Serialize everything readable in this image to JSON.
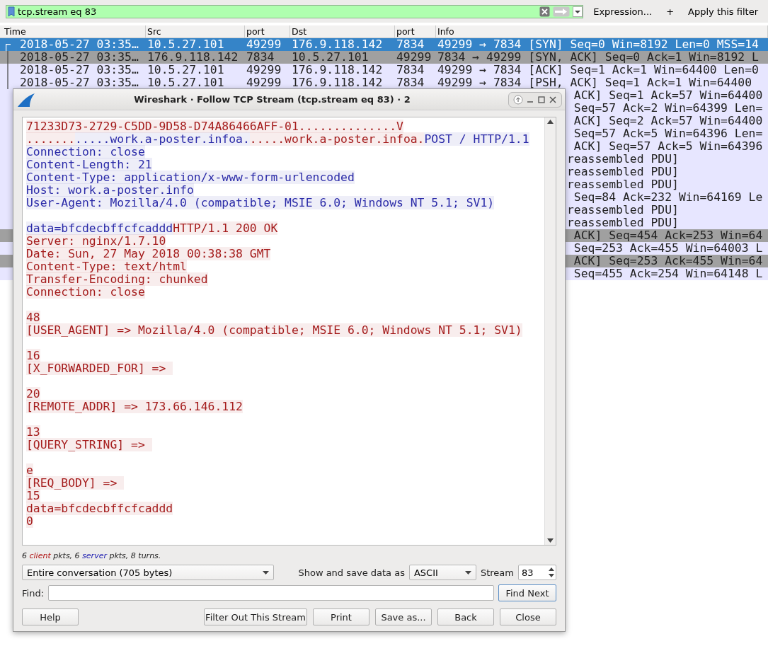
{
  "filter": {
    "value": "tcp.stream eq 83",
    "expression": "Expression...",
    "plus": "+",
    "apply": "Apply this filter"
  },
  "packet_list": {
    "columns": [
      "Time",
      "Src",
      "port",
      "Dst",
      "port",
      "Info"
    ],
    "rows": [
      {
        "kind": "full",
        "time": "2018-05-27 03:35…",
        "src": "10.5.27.101",
        "sport": "49299",
        "dst": "176.9.118.142",
        "dport": "7834",
        "info": "49299 → 7834 [SYN] Seq=0 Win=8192 Len=0 MSS=14",
        "selected": true
      },
      {
        "kind": "full",
        "time": "2018-05-27 03:35…",
        "src": "176.9.118.142",
        "sport": "7834",
        "dst": "10.5.27.101",
        "dport": "49299",
        "info": "7834 → 49299 [SYN, ACK] Seq=0 Ack=1 Win=8192 L",
        "color": "#a0a0a0",
        "selected": false
      },
      {
        "kind": "full",
        "time": "2018-05-27 03:35…",
        "src": "10.5.27.101",
        "sport": "49299",
        "dst": "176.9.118.142",
        "dport": "7834",
        "info": "49299 → 7834 [ACK] Seq=1 Ack=1 Win=64400 Len=0",
        "color": "#e7e6ff",
        "selected": false
      },
      {
        "kind": "full",
        "time": "2018-05-27 03:35…",
        "src": "10.5.27.101",
        "sport": "49299",
        "dst": "176.9.118.142",
        "dport": "7834",
        "info": "49299 → 7834 [PSH, ACK] Seq=1 Ack=1 Win=64400",
        "color": "#e7e6ff",
        "selected": false
      },
      {
        "kind": "tail",
        "info": " ACK] Seq=1 Ack=57 Win=64400",
        "color": "#e7e6ff",
        "selected": false
      },
      {
        "kind": "tail",
        "info": " Seq=57 Ack=2 Win=64399 Len=",
        "color": "#e7e6ff",
        "selected": false
      },
      {
        "kind": "tail",
        "info": " ACK] Seq=2 Ack=57 Win=64400",
        "color": "#e7e6ff",
        "selected": false
      },
      {
        "kind": "tail",
        "info": " Seq=57 Ack=5 Win=64396 Len=",
        "color": "#e7e6ff",
        "selected": false
      },
      {
        "kind": "tail",
        "info": " ACK] Seq=57 Ack=5 Win=64396",
        "color": "#e7e6ff",
        "selected": false
      },
      {
        "kind": "tail",
        "info": "reassembled PDU]",
        "color": "#e7e6ff",
        "selected": false
      },
      {
        "kind": "tail",
        "info": "reassembled PDU]",
        "color": "#e7e6ff",
        "selected": false
      },
      {
        "kind": "tail",
        "info": "reassembled PDU]",
        "color": "#e7e6ff",
        "selected": false
      },
      {
        "kind": "tail",
        "info": " Seq=84 Ack=232 Win=64169 Le",
        "color": "#e7e6ff",
        "selected": false
      },
      {
        "kind": "tail",
        "info": "reassembled PDU]",
        "color": "#e7e6ff",
        "selected": false
      },
      {
        "kind": "tail",
        "info": "reassembled PDU]",
        "color": "#e7e6ff",
        "selected": false
      },
      {
        "kind": "tail",
        "info": " ACK] Seq=454 Ack=253 Win=64",
        "color": "#a0a0a0",
        "selected": false
      },
      {
        "kind": "tail",
        "info": " Seq=253 Ack=455 Win=64003 L",
        "color": "#e7e6ff",
        "selected": false
      },
      {
        "kind": "tail",
        "info": " ACK] Seq=253 Ack=455 Win=64",
        "color": "#a0a0a0",
        "selected": false
      },
      {
        "kind": "tail",
        "info": " Seq=455 Ack=254 Win=64148 L",
        "color": "#e7e6ff",
        "selected": false
      }
    ]
  },
  "dialog": {
    "title": "Wireshark · Follow TCP Stream (tcp.stream eq 83) · 2",
    "lines": [
      {
        "segments": [
          {
            "text": "71233D73-2729-C5DD-9D58-D74A86466AFF-01..............V",
            "color": "#a51d1d"
          }
        ]
      },
      {
        "segments": [
          {
            "text": ".......",
            "color": "#a51d1d"
          },
          {
            "text": ".....work.a-poster.infoa.",
            "color": "#2b2ba8"
          },
          {
            "text": ".....work.a-poster.infoa.",
            "color": "#a51d1d"
          },
          {
            "text": "POST / HTTP/1.1",
            "color": "#2b2ba8"
          }
        ]
      },
      {
        "segments": [
          {
            "text": "Connection: close",
            "color": "#2b2ba8"
          }
        ]
      },
      {
        "segments": [
          {
            "text": "Content-Length: 21",
            "color": "#2b2ba8"
          }
        ]
      },
      {
        "segments": [
          {
            "text": "Content-Type: application/x-www-form-urlencoded",
            "color": "#2b2ba8"
          }
        ]
      },
      {
        "segments": [
          {
            "text": "Host: work.a-poster.info",
            "color": "#2b2ba8"
          }
        ]
      },
      {
        "segments": [
          {
            "text": "User-Agent: Mozilla/4.0 (compatible; MSIE 6.0; Windows NT 5.1; SV1)",
            "color": "#2b2ba8"
          }
        ]
      },
      {
        "space_before": true,
        "segments": [
          {
            "text": "data=bfcdecbffcfcaddd",
            "color": "#2b2ba8"
          },
          {
            "text": "HTTP/1.1 200 OK",
            "color": "#a51d1d"
          }
        ]
      },
      {
        "segments": [
          {
            "text": "Server: nginx/1.7.10",
            "color": "#a51d1d"
          }
        ]
      },
      {
        "segments": [
          {
            "text": "Date: Sun, 27 May 2018 00:38:38 GMT",
            "color": "#a51d1d"
          }
        ]
      },
      {
        "segments": [
          {
            "text": "Content-Type: text/html",
            "color": "#a51d1d"
          }
        ]
      },
      {
        "segments": [
          {
            "text": "Transfer-Encoding: chunked",
            "color": "#a51d1d"
          }
        ]
      },
      {
        "segments": [
          {
            "text": "Connection: close",
            "color": "#a51d1d"
          }
        ]
      },
      {
        "space_before": true,
        "segments": [
          {
            "text": "48",
            "color": "#a51d1d"
          }
        ]
      },
      {
        "segments": [
          {
            "text": "[USER_AGENT] => Mozilla/4.0 (compatible; MSIE 6.0; Windows NT 5.1; SV1)",
            "color": "#a51d1d"
          }
        ]
      },
      {
        "space_before": true,
        "segments": [
          {
            "text": "16",
            "color": "#a51d1d"
          }
        ]
      },
      {
        "segments": [
          {
            "text": "[X_FORWARDED_FOR] => ",
            "color": "#a51d1d"
          }
        ]
      },
      {
        "space_before": true,
        "segments": [
          {
            "text": "20",
            "color": "#a51d1d"
          }
        ]
      },
      {
        "segments": [
          {
            "text": "[REMOTE_ADDR] => 173.66.146.112",
            "color": "#a51d1d"
          }
        ]
      },
      {
        "space_before": true,
        "segments": [
          {
            "text": "13",
            "color": "#a51d1d"
          }
        ]
      },
      {
        "segments": [
          {
            "text": "[QUERY_STRING] => ",
            "color": "#a51d1d"
          }
        ]
      },
      {
        "space_before": true,
        "segments": [
          {
            "text": "e",
            "color": "#a51d1d"
          }
        ]
      },
      {
        "segments": [
          {
            "text": "[REQ_BODY] => ",
            "color": "#a51d1d"
          }
        ]
      },
      {
        "segments": [
          {
            "text": "15",
            "color": "#a51d1d"
          }
        ]
      },
      {
        "segments": [
          {
            "text": "data=bfcdecbffcfcaddd",
            "color": "#a51d1d"
          }
        ]
      },
      {
        "segments": [
          {
            "text": "0",
            "color": "#a51d1d"
          }
        ]
      }
    ],
    "summary": [
      {
        "text": "6 ",
        "color": "#222222"
      },
      {
        "text": "client",
        "color": "#b01010"
      },
      {
        "text": " pkts, 6 ",
        "color": "#222222"
      },
      {
        "text": "server",
        "color": "#1a1ab0"
      },
      {
        "text": " pkts, 8 turns.",
        "color": "#222222"
      }
    ],
    "conversation": "Entire conversation (705 bytes)",
    "show_as_label": "Show and save data as",
    "show_as": "ASCII",
    "stream_label": "Stream",
    "stream_number": "83",
    "find_label": "Find:",
    "find_next": {
      "label": "Find Next",
      "focused": true
    },
    "buttons": [
      "Help",
      "Filter Out This Stream",
      "Print",
      "Save as...",
      "Back",
      "Close"
    ]
  }
}
